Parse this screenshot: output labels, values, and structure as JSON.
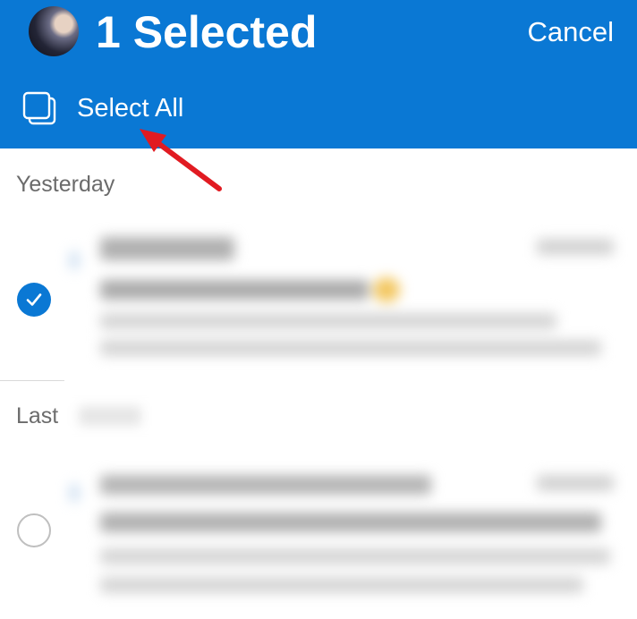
{
  "header": {
    "title": "1 Selected",
    "cancel_label": "Cancel",
    "select_all_label": "Select All",
    "background_color": "#0a78d4"
  },
  "sections": [
    {
      "label": "Yesterday"
    },
    {
      "label": "Last"
    }
  ],
  "emails": [
    {
      "selected": true,
      "icon": "checkmark-icon"
    },
    {
      "selected": false,
      "icon": "empty-circle-icon"
    }
  ],
  "icons": {
    "select_all": "stacked-squares-icon",
    "annotation": "red-arrow-annotation"
  },
  "colors": {
    "accent": "#0a78d4",
    "annotation": "#e11b22",
    "muted_text": "#6b6b6b"
  }
}
